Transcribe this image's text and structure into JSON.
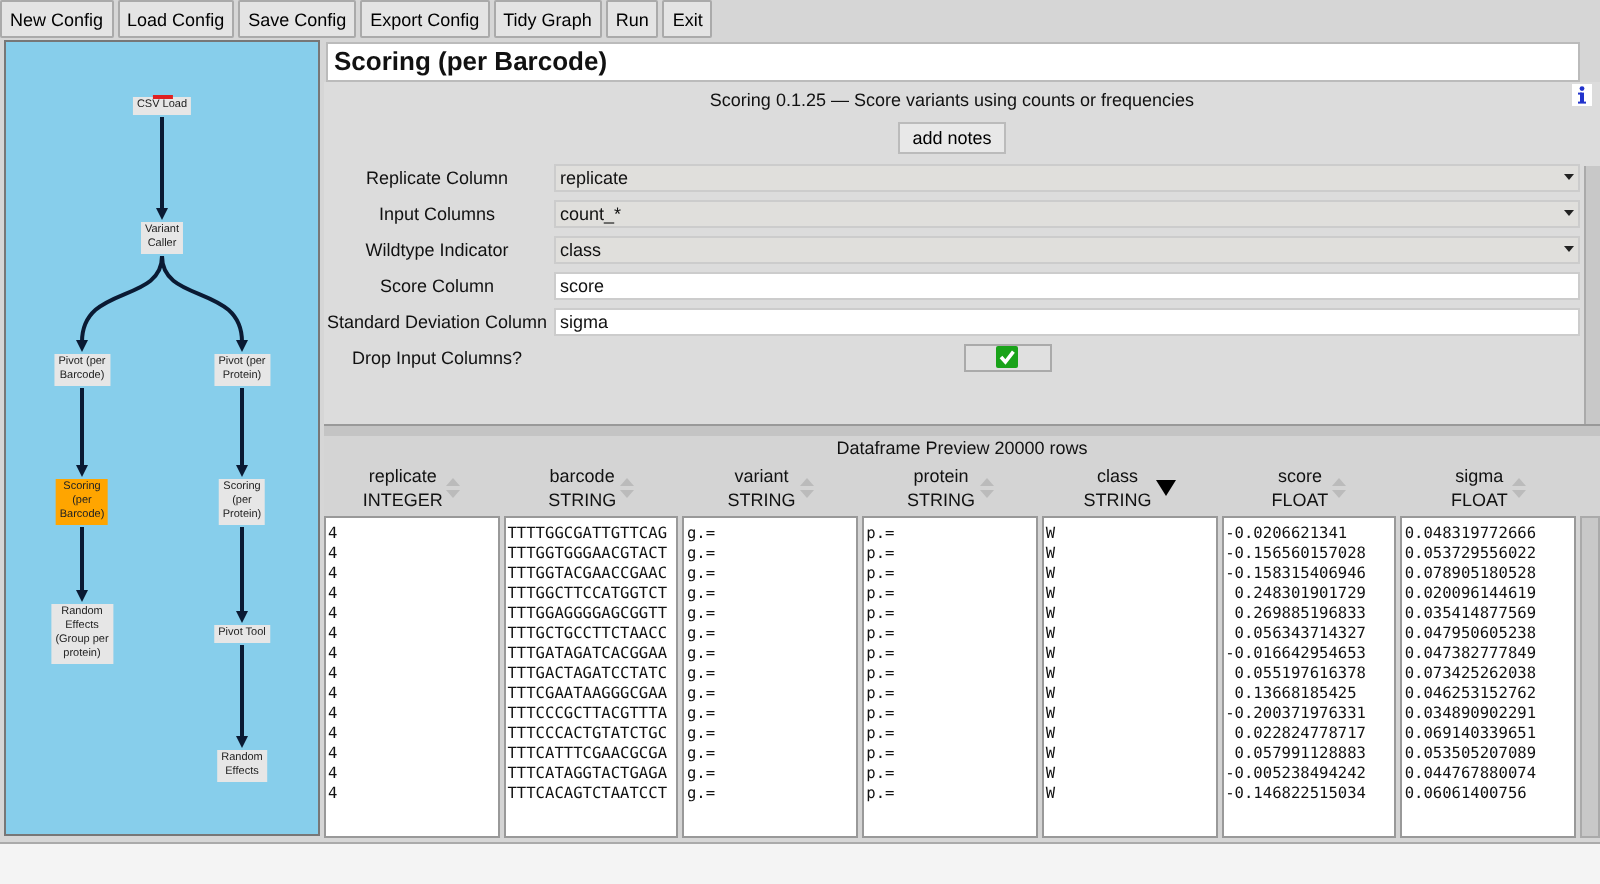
{
  "toolbar": [
    "New Config",
    "Load Config",
    "Save Config",
    "Export Config",
    "Tidy Graph",
    "Run",
    "Exit"
  ],
  "graph": {
    "nodes": [
      {
        "label": "CSV Load",
        "selected": false,
        "flag": true,
        "children": [
          {
            "label": "Variant\nCaller",
            "selected": false,
            "flag": false,
            "children": [
              {
                "label": "Pivot (per\nBarcode)",
                "selected": false,
                "flag": false,
                "children": [
                  {
                    "label": "Scoring\n(per\nBarcode)",
                    "selected": true,
                    "flag": false,
                    "children": [
                      {
                        "label": "Random\nEffects\n(Group per\nprotein)",
                        "selected": false,
                        "flag": false
                      }
                    ]
                  }
                ]
              },
              {
                "label": "Pivot (per\nProtein)",
                "selected": false,
                "flag": false,
                "children": [
                  {
                    "label": "Scoring\n(per\nProtein)",
                    "selected": false,
                    "flag": false,
                    "children": [
                      {
                        "label": "Pivot Tool",
                        "selected": false,
                        "flag": false,
                        "children": [
                          {
                            "label": "Random\nEffects",
                            "selected": false,
                            "flag": false
                          }
                        ]
                      }
                    ]
                  }
                ]
              }
            ]
          }
        ]
      }
    ]
  },
  "panel": {
    "title": "Scoring (per Barcode)",
    "description": "Scoring 0.1.25 — Score variants using counts or frequencies",
    "notes_button": "add notes",
    "fields": [
      {
        "label": "Replicate Column",
        "kind": "dropdown",
        "value": "replicate"
      },
      {
        "label": "Input Columns",
        "kind": "dropdown",
        "value": "count_*"
      },
      {
        "label": "Wildtype Indicator",
        "kind": "dropdown",
        "value": "class"
      },
      {
        "label": "Score Column",
        "kind": "text",
        "value": "score"
      },
      {
        "label": "Standard Deviation Column",
        "kind": "text",
        "value": "sigma"
      },
      {
        "label": "Drop Input Columns?",
        "kind": "checkbox",
        "checked": true
      }
    ]
  },
  "preview": {
    "title": "Dataframe Preview 20000 rows",
    "columns": [
      {
        "name": "replicate",
        "type": "INTEGER",
        "sorted": false
      },
      {
        "name": "barcode",
        "type": "STRING",
        "sorted": false
      },
      {
        "name": "variant",
        "type": "STRING",
        "sorted": false
      },
      {
        "name": "protein",
        "type": "STRING",
        "sorted": false
      },
      {
        "name": "class",
        "type": "STRING",
        "sorted": true
      },
      {
        "name": "score",
        "type": "FLOAT",
        "sorted": false
      },
      {
        "name": "sigma",
        "type": "FLOAT",
        "sorted": false
      }
    ],
    "rows": [
      [
        "4",
        "TTTTGGCGATTGTTCAG",
        "g.=",
        "p.=",
        "W",
        "-0.0206621341",
        "0.048319772666"
      ],
      [
        "4",
        "TTTGGTGGGAACGTACT",
        "g.=",
        "p.=",
        "W",
        "-0.156560157028",
        "0.053729556022"
      ],
      [
        "4",
        "TTTGGTACGAACCGAAC",
        "g.=",
        "p.=",
        "W",
        "-0.158315406946",
        "0.078905180528"
      ],
      [
        "4",
        "TTTGGCTTCCATGGTCT",
        "g.=",
        "p.=",
        "W",
        " 0.248301901729",
        "0.020096144619"
      ],
      [
        "4",
        "TTTGGAGGGGAGCGGTT",
        "g.=",
        "p.=",
        "W",
        " 0.269885196833",
        "0.035414877569"
      ],
      [
        "4",
        "TTTGCTGCCTTCTAACC",
        "g.=",
        "p.=",
        "W",
        " 0.056343714327",
        "0.047950605238"
      ],
      [
        "4",
        "TTTGATAGATCACGGAA",
        "g.=",
        "p.=",
        "W",
        "-0.016642954653",
        "0.047382777849"
      ],
      [
        "4",
        "TTTGACTAGATCCTATC",
        "g.=",
        "p.=",
        "W",
        " 0.055197616378",
        "0.073425262038"
      ],
      [
        "4",
        "TTTCGAATAAGGGCGAA",
        "g.=",
        "p.=",
        "W",
        " 0.13668185425",
        "0.046253152762"
      ],
      [
        "4",
        "TTTCCCGCTTACGTTTA",
        "g.=",
        "p.=",
        "W",
        "-0.200371976331",
        "0.034890902291"
      ],
      [
        "4",
        "TTTCCCACTGTATCTGC",
        "g.=",
        "p.=",
        "W",
        " 0.022824778717",
        "0.069140339651"
      ],
      [
        "4",
        "TTTCATTTCGAACGCGA",
        "g.=",
        "p.=",
        "W",
        " 0.057991128883",
        "0.053505207089"
      ],
      [
        "4",
        "TTTCATAGGTACTGAGA",
        "g.=",
        "p.=",
        "W",
        "-0.005238494242",
        "0.044767880074"
      ],
      [
        "4",
        "TTTCACAGTCTAATCCT",
        "g.=",
        "p.=",
        "W",
        "-0.146822515034",
        "0.06061400756"
      ]
    ]
  }
}
